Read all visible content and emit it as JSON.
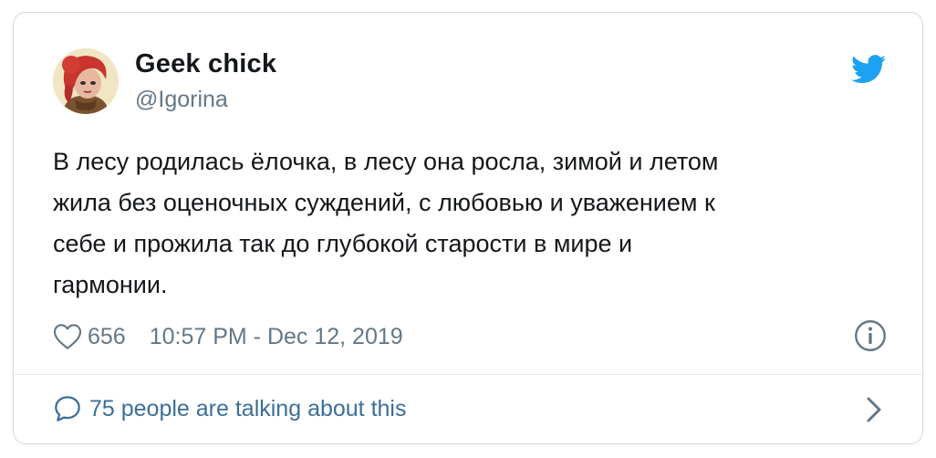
{
  "tweet": {
    "author_name": "Geek chick",
    "author_handle": "@Igorina",
    "text": "В лесу родилась ёлочка, в лесу она росла, зимой и летом\nжила без оценочных суждений, с любовью и уважением к\nсебе и прожила так до глубокой старости в мире и\nгармонии.",
    "likes": "656",
    "timestamp": "10:57 PM - Dec 12, 2019",
    "conversation_link": "75 people are talking about this"
  },
  "icons": {
    "brand": "twitter-bird-icon",
    "like": "heart-icon",
    "info": "info-icon",
    "conversation": "speech-bubble-icon",
    "next": "chevron-right-icon"
  },
  "colors": {
    "brand_blue": "#1da1f2",
    "link_blue": "#3b6f99",
    "secondary_text": "#657786",
    "primary_text": "#14171a",
    "border": "#cfd9de"
  }
}
